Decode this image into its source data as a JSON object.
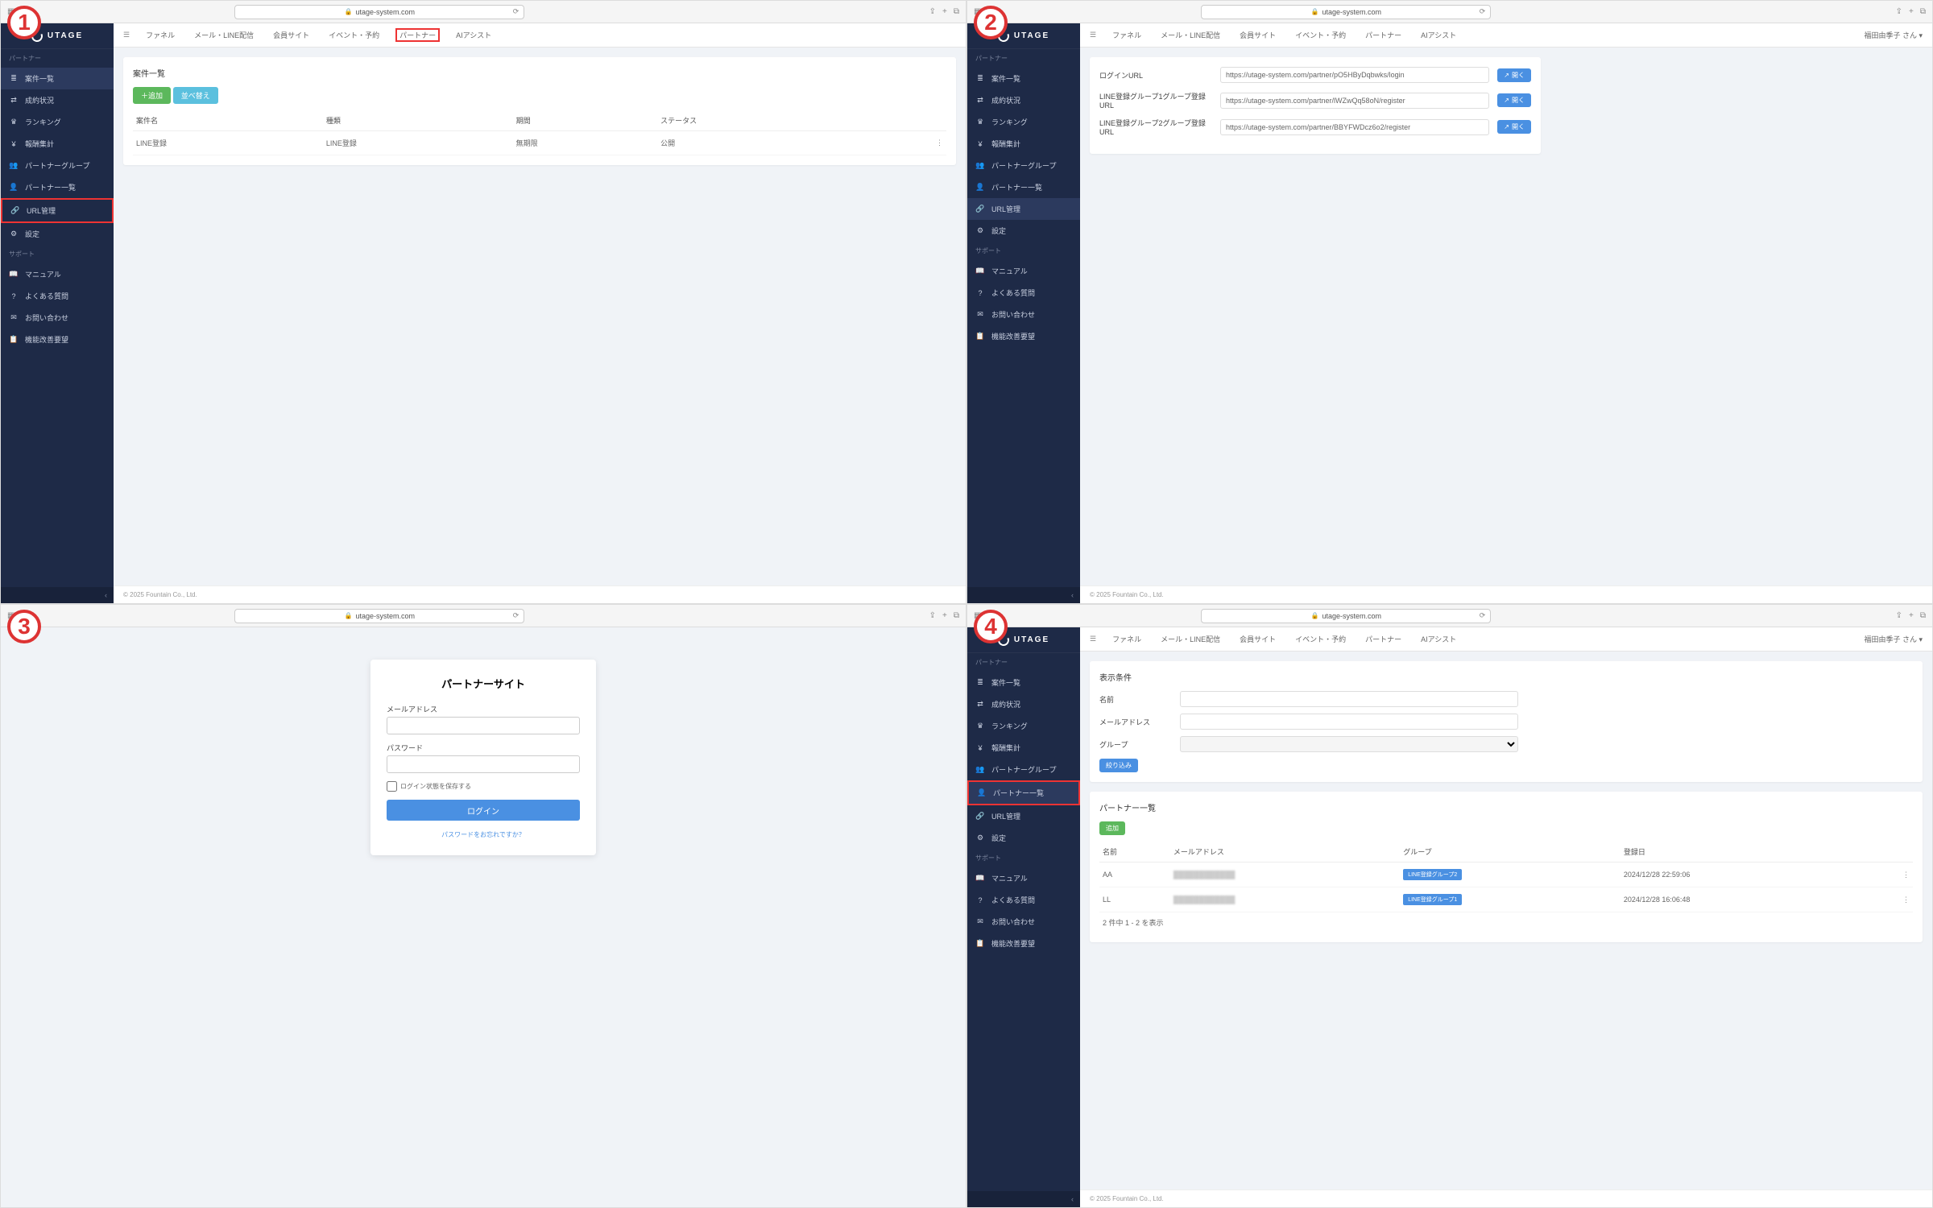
{
  "badges": [
    "1",
    "2",
    "3",
    "4"
  ],
  "browser": {
    "url": "utage-system.com",
    "back": "‹",
    "fwd": "›",
    "share": "⇪",
    "plus": "+",
    "tabs": "⧉",
    "reload": "⟳",
    "lock": "🔒"
  },
  "logo": "UTAGE",
  "topnav": {
    "items": [
      "ファネル",
      "メール・LINE配信",
      "会員サイト",
      "イベント・予約",
      "パートナー",
      "AIアシスト"
    ],
    "user": "福田由季子 さん ▾"
  },
  "sidebar": {
    "section1": "パートナー",
    "items": [
      {
        "icon": "≣",
        "label": "案件一覧"
      },
      {
        "icon": "⇄",
        "label": "成約状況"
      },
      {
        "icon": "♛",
        "label": "ランキング"
      },
      {
        "icon": "¥",
        "label": "報酬集計"
      },
      {
        "icon": "👥",
        "label": "パートナーグループ"
      },
      {
        "icon": "👤",
        "label": "パートナー一覧"
      },
      {
        "icon": "🔗",
        "label": "URL管理"
      },
      {
        "icon": "⚙",
        "label": "設定"
      }
    ],
    "section2": "サポート",
    "support": [
      {
        "icon": "📖",
        "label": "マニュアル"
      },
      {
        "icon": "?",
        "label": "よくある質問"
      },
      {
        "icon": "✉",
        "label": "お問い合わせ"
      },
      {
        "icon": "📋",
        "label": "機能改善要望"
      }
    ],
    "collapse": "‹"
  },
  "panel1": {
    "title": "案件一覧",
    "add": "＋追加",
    "swap": "並べ替え",
    "cols": [
      "案件名",
      "種類",
      "期間",
      "ステータス"
    ],
    "row": {
      "name": "LINE登録",
      "type": "LINE登録",
      "period": "無期限",
      "status": "公開"
    }
  },
  "panel2": {
    "rows": [
      {
        "label": "ログインURL",
        "value": "https://utage-system.com/partner/pO5HByDqbwks/login",
        "btn": "開く"
      },
      {
        "label": "LINE登録グループ1グループ登録URL",
        "value": "https://utage-system.com/partner/lWZwQq58oN/register",
        "btn": "開く"
      },
      {
        "label": "LINE登録グループ2グループ登録URL",
        "value": "https://utage-system.com/partner/BBYFWDcz6o2/register",
        "btn": "開く"
      }
    ]
  },
  "panel3": {
    "title": "パートナーサイト",
    "email_label": "メールアドレス",
    "pw_label": "パスワード",
    "remember": "ログイン状態を保存する",
    "login": "ログイン",
    "forgot": "パスワードをお忘れですか？"
  },
  "panel4": {
    "filter_title": "表示条件",
    "f_name": "名前",
    "f_email": "メールアドレス",
    "f_group": "グループ",
    "f_submit": "絞り込み",
    "list_title": "パートナー一覧",
    "add": "追加",
    "cols": [
      "名前",
      "メールアドレス",
      "グループ",
      "登録日"
    ],
    "rows": [
      {
        "name": "AA",
        "email": "████████████",
        "group": "LINE登録グループ2",
        "date": "2024/12/28 22:59:06"
      },
      {
        "name": "LL",
        "email": "████████████",
        "group": "LINE登録グループ1",
        "date": "2024/12/28 16:06:48"
      }
    ],
    "pager": "2 件中 1 - 2 を表示"
  },
  "footer": "© 2025 Fountain Co., Ltd."
}
